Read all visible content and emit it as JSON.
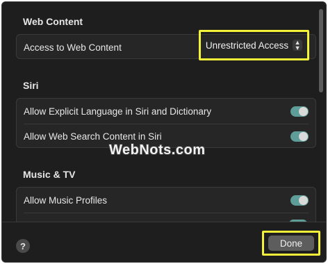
{
  "sections": {
    "web_content": {
      "title": "Web Content",
      "access_label": "Access to Web Content",
      "access_value": "Unrestricted Access"
    },
    "siri": {
      "title": "Siri",
      "rows": [
        {
          "label": "Allow Explicit Language in Siri and Dictionary",
          "enabled": true
        },
        {
          "label": "Allow Web Search Content in Siri",
          "enabled": true
        }
      ]
    },
    "music_tv": {
      "title": "Music & TV",
      "rows": [
        {
          "label": "Allow Music Profiles",
          "enabled": true
        }
      ]
    }
  },
  "footer": {
    "help_label": "?",
    "done_label": "Done"
  },
  "watermark": "WebNots.com",
  "colors": {
    "highlight": "#f5f23a",
    "toggle_on": "#5f9e98"
  }
}
